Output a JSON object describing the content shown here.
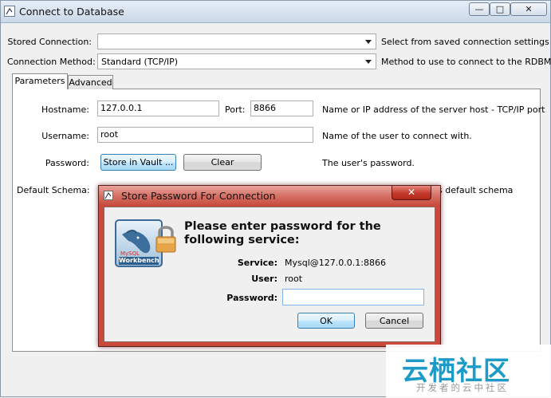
{
  "window": {
    "title": "Connect to Database",
    "controls": {
      "minimize": "—",
      "maximize": "□",
      "close": "✕"
    }
  },
  "form": {
    "stored_connection": {
      "label": "Stored Connection:",
      "value": "",
      "hint": "Select from saved connection settings"
    },
    "connection_method": {
      "label": "Connection Method:",
      "value": "Standard (TCP/IP)",
      "hint": "Method to use to connect to the RDBMS"
    }
  },
  "tabs": [
    {
      "label": "Parameters",
      "active": true
    },
    {
      "label": "Advanced",
      "active": false
    }
  ],
  "parameters": {
    "hostname": {
      "label": "Hostname:",
      "value": "127.0.0.1"
    },
    "port": {
      "label": "Port:",
      "value": "8866"
    },
    "hostname_hint": "Name or IP address of the server host - TCP/IP port",
    "username": {
      "label": "Username:",
      "value": "root",
      "hint": "Name of the user to connect with."
    },
    "password": {
      "label": "Password:",
      "store_button": "Store in Vault ...",
      "clear_button": "Clear",
      "hint": "The user's password."
    },
    "default_schema": {
      "label": "Default Schema:",
      "hint_partial": "s default schema"
    }
  },
  "dialog": {
    "title": "Store Password For Connection",
    "close": "✕",
    "logo_text_small": "MySQL",
    "logo_text": "Workbench",
    "heading": "Please enter password for the following service:",
    "service_label": "Service:",
    "service_value": "Mysql@127.0.0.1:8866",
    "user_label": "User:",
    "user_value": "root",
    "password_label": "Password:",
    "password_value": "",
    "ok_button": "OK",
    "cancel_button": "Cancel"
  },
  "watermark": {
    "logo": "云栖社区",
    "subtitle": "开发者的云中社区"
  },
  "icons": [
    "app-icon",
    "dropdown-arrow-icon",
    "mysql-workbench-logo-icon",
    "padlock-icon",
    "close-icon"
  ],
  "colors": {
    "dialog_frame": "#c9493a",
    "titlebar": "#cbd8e8",
    "watermark": "#1d9bc8",
    "focus_border": "#3c7fb1"
  }
}
